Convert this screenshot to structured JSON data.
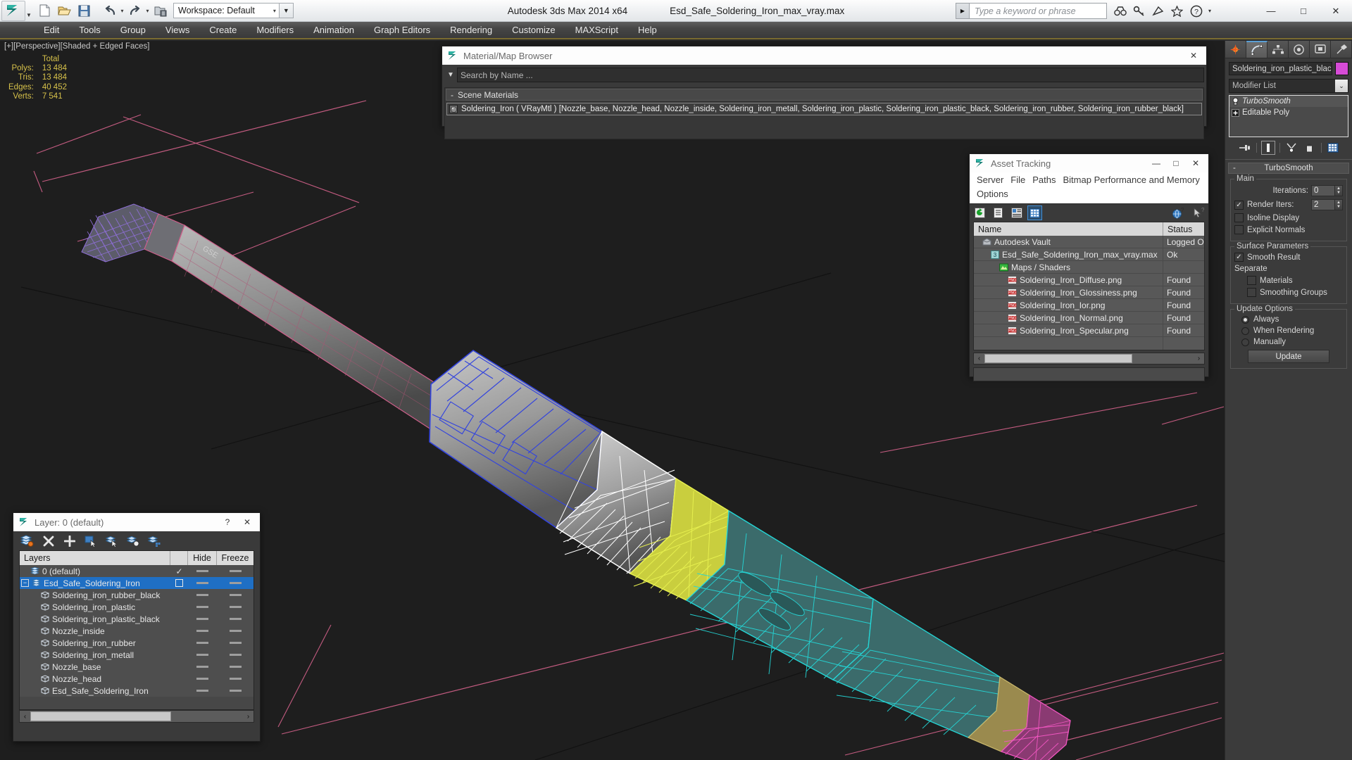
{
  "window": {
    "app_title": "Autodesk 3ds Max  2014 x64",
    "file_title": "Esd_Safe_Soldering_Iron_max_vray.max",
    "minimize": "—",
    "maximize": "□",
    "close": "✕"
  },
  "quick_access": {
    "workspace_label": "Workspace: Default",
    "workspace_caret": "▾",
    "dropdown_arrow": "▼",
    "buttons": [
      {
        "name": "new-file-icon",
        "tip": "New"
      },
      {
        "name": "open-file-icon",
        "tip": "Open"
      },
      {
        "name": "save-file-icon",
        "tip": "Save"
      },
      {
        "name": "undo-icon",
        "tip": "Undo"
      },
      {
        "name": "redo-icon",
        "tip": "Redo"
      },
      {
        "name": "project-folder-icon",
        "tip": "Set Project Folder"
      }
    ]
  },
  "search": {
    "placeholder": "Type a keyword or phrase",
    "caret": "▶",
    "icons": [
      "binoculars-icon",
      "key-icon",
      "satellite-icon",
      "star-icon",
      "help-icon"
    ],
    "help_caret": "▾"
  },
  "menubar": {
    "items": [
      "Edit",
      "Tools",
      "Group",
      "Views",
      "Create",
      "Modifiers",
      "Animation",
      "Graph Editors",
      "Rendering",
      "Customize",
      "MAXScript",
      "Help"
    ]
  },
  "viewport": {
    "label": "[+][Perspective][Shaded + Edged Faces]",
    "stats_header": "Total",
    "stats": [
      {
        "label": "Polys:",
        "value": "13 484"
      },
      {
        "label": "Tris:",
        "value": "13 484"
      },
      {
        "label": "Edges:",
        "value": "40 452"
      },
      {
        "label": "Verts:",
        "value": "7 541"
      }
    ]
  },
  "material_browser": {
    "title": "Material/Map Browser",
    "close": "✕",
    "search_placeholder": "Search by Name ...",
    "filter_caret": "▼",
    "group_label": "Scene Materials",
    "group_toggle": "-",
    "material_entry": "Soldering_Iron ( VRayMtl ) [Nozzle_base, Nozzle_head, Nozzle_inside, Soldering_iron_metall, Soldering_iron_plastic, Soldering_iron_plastic_black, Soldering_iron_rubber, Soldering_iron_rubber_black]"
  },
  "asset_tracking": {
    "title": "Asset Tracking",
    "minimize": "—",
    "maximize": "□",
    "close": "✕",
    "menus": [
      "Server",
      "File",
      "Paths",
      "Bitmap Performance and Memory",
      "Options"
    ],
    "toolbar_icons": [
      "refresh-icon",
      "list-view-icon",
      "detail-view-icon",
      "grid-view-icon",
      "help-globe-icon",
      "help-arrow-icon"
    ],
    "columns": [
      "Name",
      "Status"
    ],
    "rows": [
      {
        "name": "Autodesk Vault",
        "status": "Logged O",
        "icon": "vault-icon",
        "indent": 1
      },
      {
        "name": "Esd_Safe_Soldering_Iron_max_vray.max",
        "status": "Ok",
        "icon": "max-file-icon",
        "indent": 2
      },
      {
        "name": "Maps / Shaders",
        "status": "",
        "icon": "maps-icon",
        "indent": 3
      },
      {
        "name": "Soldering_Iron_Diffuse.png",
        "status": "Found",
        "icon": "png-icon",
        "indent": 4
      },
      {
        "name": "Soldering_Iron_Glossiness.png",
        "status": "Found",
        "icon": "png-icon",
        "indent": 4
      },
      {
        "name": "Soldering_Iron_Ior.png",
        "status": "Found",
        "icon": "png-icon",
        "indent": 4
      },
      {
        "name": "Soldering_Iron_Normal.png",
        "status": "Found",
        "icon": "png-icon",
        "indent": 4
      },
      {
        "name": "Soldering_Iron_Specular.png",
        "status": "Found",
        "icon": "png-icon",
        "indent": 4
      }
    ],
    "scroll_left": "‹",
    "scroll_right": "›"
  },
  "layer_manager": {
    "title": "Layer: 0 (default)",
    "help": "?",
    "close": "✕",
    "toolbar_icons": [
      "create-new-layer-icon",
      "delete-layer-icon",
      "add-selection-icon",
      "select-objects-icon",
      "select-highlighted-icon",
      "highlight-selected-icon",
      "hide-unhide-icon"
    ],
    "columns": {
      "layers": "Layers",
      "hide": "Hide",
      "freeze": "Freeze"
    },
    "rows": [
      {
        "name": "0 (default)",
        "type": "layer",
        "indent": 1,
        "current": true,
        "selected": false
      },
      {
        "name": "Esd_Safe_Soldering_Iron",
        "type": "layer",
        "indent": 0,
        "current": false,
        "selected": true,
        "expander": "−"
      },
      {
        "name": "Soldering_iron_rubber_black",
        "type": "object",
        "indent": 2,
        "selected": false
      },
      {
        "name": "Soldering_iron_plastic",
        "type": "object",
        "indent": 2,
        "selected": false
      },
      {
        "name": "Soldering_iron_plastic_black",
        "type": "object",
        "indent": 2,
        "selected": false
      },
      {
        "name": "Nozzle_inside",
        "type": "object",
        "indent": 2,
        "selected": false
      },
      {
        "name": "Soldering_iron_rubber",
        "type": "object",
        "indent": 2,
        "selected": false
      },
      {
        "name": "Soldering_iron_metall",
        "type": "object",
        "indent": 2,
        "selected": false
      },
      {
        "name": "Nozzle_base",
        "type": "object",
        "indent": 2,
        "selected": false
      },
      {
        "name": "Nozzle_head",
        "type": "object",
        "indent": 2,
        "selected": false
      },
      {
        "name": "Esd_Safe_Soldering_Iron",
        "type": "object",
        "indent": 2,
        "selected": false
      }
    ],
    "check_mark": "✓",
    "scroll_left": "‹",
    "scroll_right": "›"
  },
  "command_panel": {
    "tabs": [
      "create-tab",
      "modify-tab",
      "hierarchy-tab",
      "motion-tab",
      "display-tab",
      "utilities-tab"
    ],
    "active_tab_index": 1,
    "object_name": "Soldering_iron_plastic_black",
    "object_color": "#d64bd6",
    "modifier_list_label": "Modifier List",
    "modifier_caret": "⌄",
    "stack": [
      {
        "label": "TurboSmooth",
        "selected": true,
        "icon": "lightbulb-icon"
      },
      {
        "label": "Editable Poly",
        "selected": false,
        "icon": "plus-box-icon"
      }
    ],
    "stack_buttons": [
      "pin-stack-icon",
      "show-end-result-icon",
      "make-unique-icon",
      "remove-modifier-icon",
      "configure-modifier-sets-icon"
    ],
    "rollout": {
      "title": "TurboSmooth",
      "toggle": "-",
      "groups": [
        {
          "title": "Main",
          "fields": [
            {
              "kind": "spinner",
              "label": "Iterations:",
              "value": "0"
            },
            {
              "kind": "check-spinner",
              "label": "Render Iters:",
              "value": "2",
              "checked": true
            },
            {
              "kind": "checkbox",
              "label": "Isoline Display",
              "checked": false
            },
            {
              "kind": "checkbox",
              "label": "Explicit Normals",
              "checked": false
            }
          ]
        },
        {
          "title": "Surface Parameters",
          "fields": [
            {
              "kind": "checkbox",
              "label": "Smooth Result",
              "checked": true
            },
            {
              "kind": "text",
              "label": "Separate"
            },
            {
              "kind": "checkbox-indent",
              "label": "Materials",
              "checked": false
            },
            {
              "kind": "checkbox-indent",
              "label": "Smoothing Groups",
              "checked": false
            }
          ]
        },
        {
          "title": "Update Options",
          "fields": [
            {
              "kind": "radio",
              "label": "Always",
              "checked": true
            },
            {
              "kind": "radio",
              "label": "When Rendering",
              "checked": false
            },
            {
              "kind": "radio",
              "label": "Manually",
              "checked": false
            },
            {
              "kind": "button",
              "label": "Update"
            }
          ]
        }
      ]
    }
  },
  "colors": {
    "accent_blue": "#1f6fc4",
    "viewport_bg": "#1e1e1e",
    "stats_yellow": "#d6c14a",
    "panel_bg": "#3b3b3b",
    "grid_pink": "#d8557f",
    "mesh_blue": "#3344dd",
    "mesh_cyan": "#24d6d6",
    "mesh_yellow": "#d8e04a",
    "mesh_magenta": "#e24ab8",
    "mesh_white": "#ffffff",
    "mesh_purple": "#8f6fd8"
  }
}
